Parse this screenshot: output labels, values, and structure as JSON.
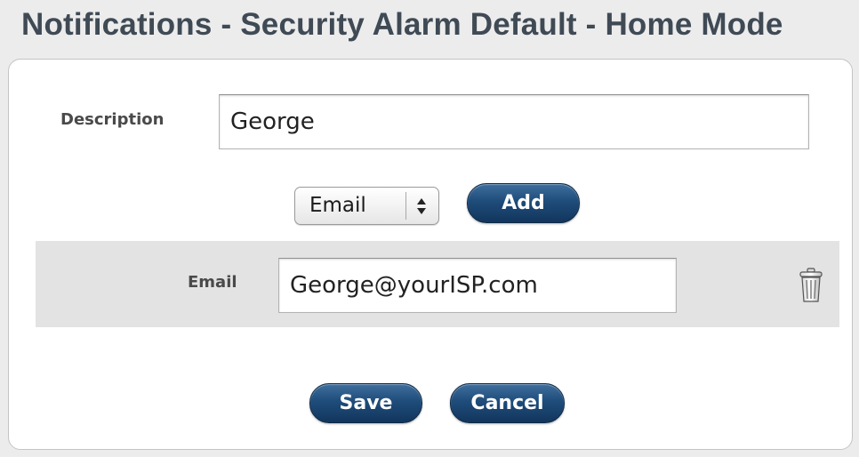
{
  "page": {
    "title": "Notifications - Security Alarm Default - Home Mode"
  },
  "form": {
    "description_label": "Description",
    "description_value": "George",
    "type_select": {
      "selected": "Email",
      "icon": "select-stepper-arrows-icon"
    },
    "add_label": "Add",
    "entries": [
      {
        "label": "Email",
        "value": "George@yourISP.com",
        "delete_icon": "trash-icon"
      }
    ],
    "save_label": "Save",
    "cancel_label": "Cancel"
  },
  "colors": {
    "title": "#3f4a55",
    "button_dark": "#12365d",
    "button_light": "#3f6f9e",
    "row_background": "#e3e3e3",
    "page_background": "#ececec"
  }
}
